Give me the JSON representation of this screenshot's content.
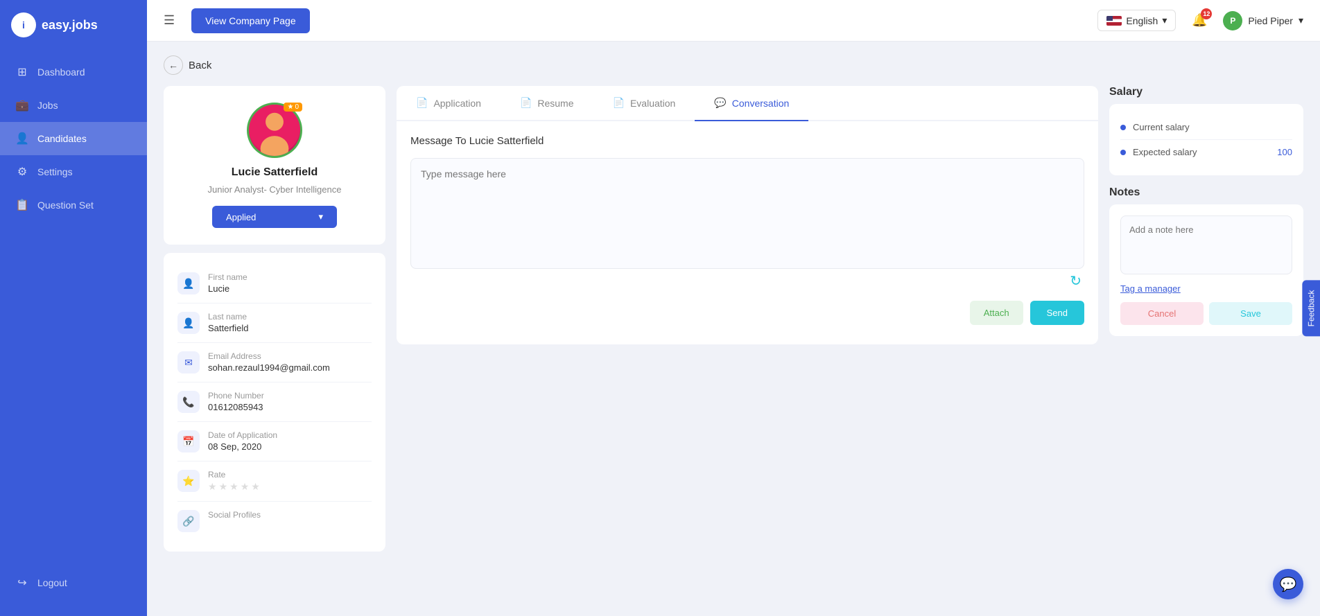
{
  "sidebar": {
    "logo_text": "easy.jobs",
    "items": [
      {
        "id": "dashboard",
        "label": "Dashboard",
        "icon": "⊞",
        "active": false
      },
      {
        "id": "jobs",
        "label": "Jobs",
        "icon": "💼",
        "active": false
      },
      {
        "id": "candidates",
        "label": "Candidates",
        "icon": "👤",
        "active": true
      },
      {
        "id": "settings",
        "label": "Settings",
        "icon": "⚙",
        "active": false
      },
      {
        "id": "question-set",
        "label": "Question Set",
        "icon": "📋",
        "active": false
      }
    ],
    "logout": "Logout"
  },
  "topbar": {
    "view_company_btn": "View Company Page",
    "language": "English",
    "notification_count": "12",
    "company_name": "Pied Piper",
    "company_icon": "P"
  },
  "back_label": "Back",
  "candidate": {
    "name": "Lucie Satterfield",
    "role": "Junior Analyst- Cyber Intelligence",
    "status": "Applied",
    "star_count": "0",
    "fields": [
      {
        "id": "first-name",
        "label": "First name",
        "value": "Lucie",
        "icon": "👤"
      },
      {
        "id": "last-name",
        "label": "Last name",
        "value": "Satterfield",
        "icon": "👤"
      },
      {
        "id": "email",
        "label": "Email Address",
        "value": "sohan.rezaul1994@gmail.com",
        "icon": "✉"
      },
      {
        "id": "phone",
        "label": "Phone Number",
        "value": "01612085943",
        "icon": "📞"
      },
      {
        "id": "date-applied",
        "label": "Date of Application",
        "value": "08 Sep, 2020",
        "icon": "📅"
      },
      {
        "id": "rate",
        "label": "Rate",
        "value": "",
        "icon": "⭐"
      },
      {
        "id": "social",
        "label": "Social Profiles",
        "value": "",
        "icon": "🔗"
      }
    ]
  },
  "tabs": [
    {
      "id": "application",
      "label": "Application",
      "icon": "📄",
      "active": false
    },
    {
      "id": "resume",
      "label": "Resume",
      "icon": "📄",
      "active": false
    },
    {
      "id": "evaluation",
      "label": "Evaluation",
      "icon": "📄",
      "active": false
    },
    {
      "id": "conversation",
      "label": "Conversation",
      "icon": "💬",
      "active": true
    }
  ],
  "conversation": {
    "message_to": "Message To Lucie Satterfield",
    "message_placeholder": "Type message here",
    "attach_label": "Attach",
    "send_label": "Send"
  },
  "salary": {
    "title": "Salary",
    "items": [
      {
        "id": "current",
        "label": "Current salary",
        "value": ""
      },
      {
        "id": "expected",
        "label": "Expected salary",
        "value": "100"
      }
    ]
  },
  "notes": {
    "title": "Notes",
    "placeholder": "Add a note here",
    "tag_label": "Tag a manager",
    "cancel_label": "Cancel",
    "save_label": "Save"
  },
  "feedback_label": "Feedback"
}
